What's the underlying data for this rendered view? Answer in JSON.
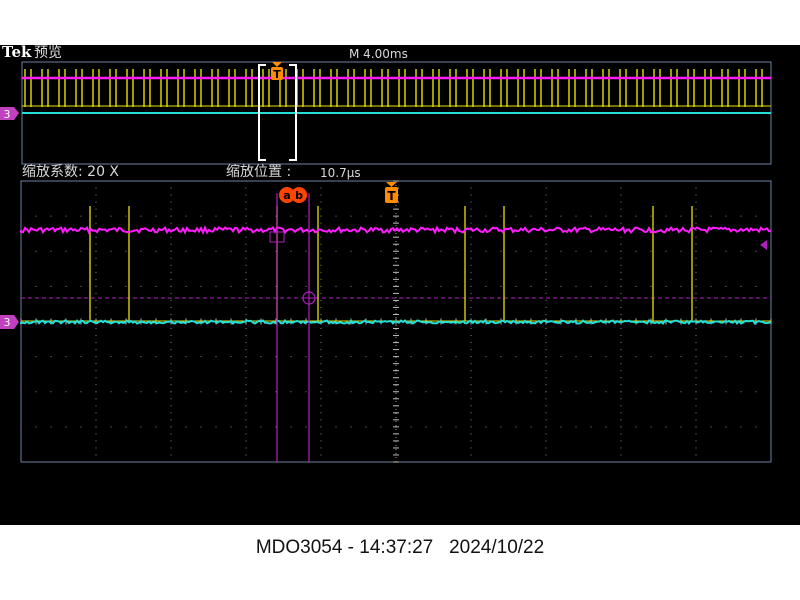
{
  "header": {
    "brand": "Tek",
    "mode_label": "预览",
    "timebase": "M 4.00ms"
  },
  "zoom": {
    "factor_label": "缩放系数: 20 X",
    "position_label": "缩放位置 :",
    "position_value": "10.7μs"
  },
  "markers": {
    "channel_ref": "3",
    "trigger": "T",
    "cursor_a": "a",
    "cursor_b": "b"
  },
  "colors": {
    "ch_yellow": "#e8e000",
    "ch_magenta": "#ff1cff",
    "ch_cyan": "#22e0d8",
    "cursor_purple": "#b020c0",
    "trigger_orange": "#ff8c00",
    "frame": "#6e7fa0",
    "grid_dot": "#8a8a8a"
  },
  "footer": {
    "text": "MDO3054 - 14:37:27   2024/10/22"
  }
}
